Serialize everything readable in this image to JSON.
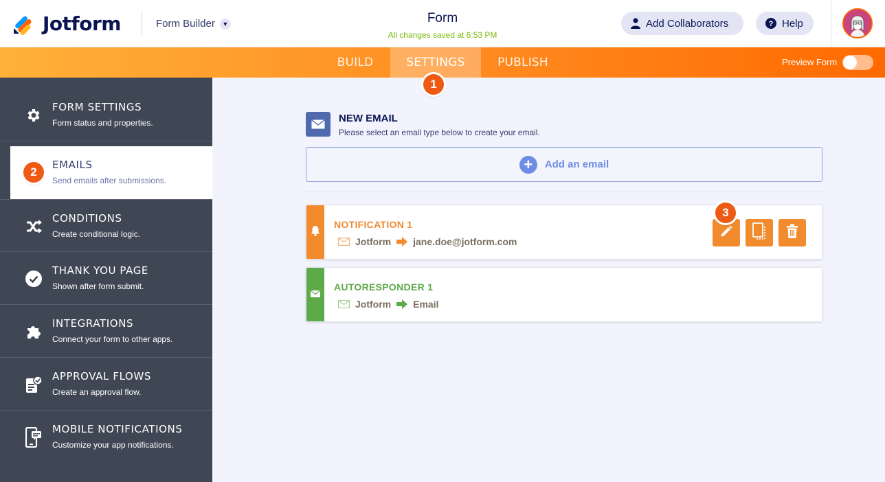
{
  "header": {
    "brand": "Jotform",
    "builder_label": "Form Builder",
    "form_title": "Form",
    "saved_status": "All changes saved at 6:53 PM",
    "collaborators_label": "Add Collaborators",
    "help_label": "Help"
  },
  "nav": {
    "tabs": [
      {
        "label": "BUILD"
      },
      {
        "label": "SETTINGS"
      },
      {
        "label": "PUBLISH"
      }
    ],
    "preview_label": "Preview Form"
  },
  "badges": [
    "1",
    "2",
    "3"
  ],
  "sidebar": {
    "items": [
      {
        "title": "FORM SETTINGS",
        "subtitle": "Form status and properties."
      },
      {
        "title": "EMAILS",
        "subtitle": "Send emails after submissions."
      },
      {
        "title": "CONDITIONS",
        "subtitle": "Create conditional logic."
      },
      {
        "title": "THANK YOU PAGE",
        "subtitle": "Shown after form submit."
      },
      {
        "title": "INTEGRATIONS",
        "subtitle": "Connect your form to other apps."
      },
      {
        "title": "APPROVAL FLOWS",
        "subtitle": "Create an approval flow."
      },
      {
        "title": "MOBILE NOTIFICATIONS",
        "subtitle": "Customize your app notifications."
      }
    ]
  },
  "main": {
    "new_email_title": "NEW EMAIL",
    "new_email_subtitle": "Please select an email type below to create your email.",
    "add_email_label": "Add an email",
    "emails": [
      {
        "title": "NOTIFICATION 1",
        "from": "Jotform",
        "to": "jane.doe@jotform.com",
        "color": "#f28a2e"
      },
      {
        "title": "AUTORESPONDER 1",
        "from": "Jotform",
        "to": "Email",
        "color": "#5daa49"
      }
    ]
  },
  "colors": {
    "accent_orange": "#ff6100",
    "sidebar_bg": "#3f4654",
    "notification": "#f28a2e",
    "autoresponder": "#5daa49",
    "badge": "#ee5a14"
  }
}
